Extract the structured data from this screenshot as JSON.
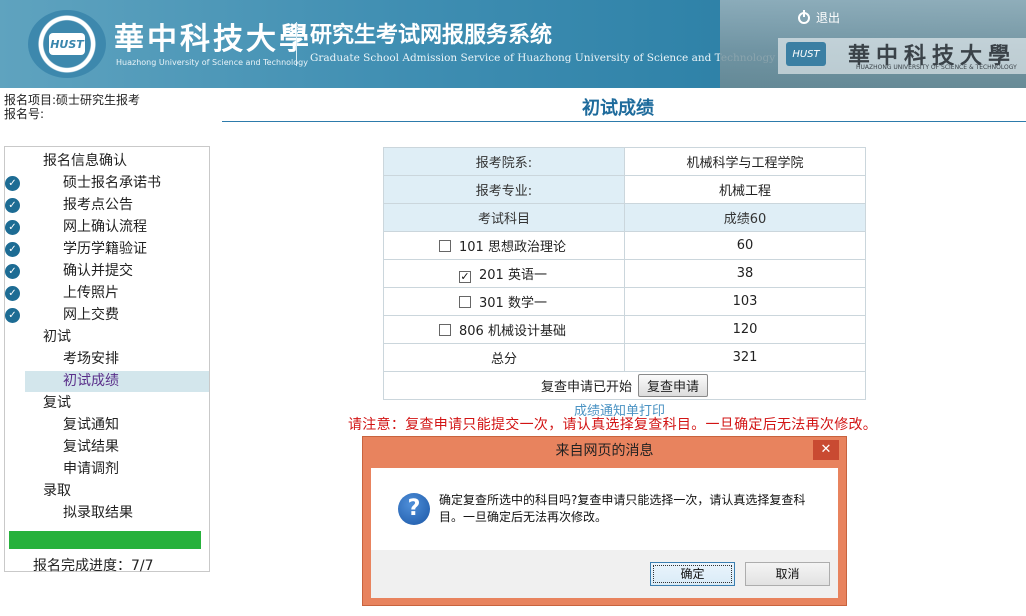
{
  "header": {
    "university_cn": "華中科技大學",
    "university_en": "Huazhong University of Science and Technology",
    "seal_text": "HUST",
    "system_cn": "研究生考试网报服务系统",
    "system_en": "Graduate School Admission Service of Huazhong University of Science and Technology",
    "photo_text": "華中科技大學",
    "photo_subtext": "HUAZHONG UNIVERSITY OF SCIENCE & TECHNOLOGY",
    "logout_label": "退出"
  },
  "info": {
    "project_label": "报名项目:",
    "project_value": "硕士研究生报考",
    "reg_no_label": "报名号:",
    "reg_no_value": ""
  },
  "page_title": "初试成绩",
  "sidebar": {
    "sections": [
      {
        "label": "报名信息确认"
      },
      {
        "label": "初试"
      },
      {
        "label": "复试"
      },
      {
        "label": "录取"
      }
    ],
    "items_reg": [
      {
        "label": "硕士报名承诺书"
      },
      {
        "label": "报考点公告"
      },
      {
        "label": "网上确认流程"
      },
      {
        "label": "学历学籍验证"
      },
      {
        "label": "确认并提交"
      },
      {
        "label": "上传照片"
      },
      {
        "label": "网上交费"
      }
    ],
    "items_prelim": [
      {
        "label": "考场安排"
      },
      {
        "label": "初试成绩"
      }
    ],
    "items_retest": [
      {
        "label": "复试通知"
      },
      {
        "label": "复试结果"
      },
      {
        "label": "申请调剂"
      }
    ],
    "items_admit": [
      {
        "label": "拟录取结果"
      }
    ],
    "progress_fraction": 1.0,
    "progress_text": "报名完成进度：7/7"
  },
  "scores": {
    "dept_label": "报考院系:",
    "dept_value": "机械科学与工程学院",
    "major_label": "报考专业:",
    "major_value": "机械工程",
    "subject_header": "考试科目",
    "score_header": "成绩60",
    "subjects": [
      {
        "name": "101 思想政治理论",
        "score": "60",
        "checked": false
      },
      {
        "name": "201 英语一",
        "score": "38",
        "checked": true
      },
      {
        "name": "301 数学一",
        "score": "103",
        "checked": false
      },
      {
        "name": "806 机械设计基础",
        "score": "120",
        "checked": false
      }
    ],
    "total_label": "总分",
    "total_value": "321",
    "recheck_status": "复查申请已开始",
    "recheck_button": "复查申请",
    "print_link": "成绩通知单打印",
    "notice": "请注意：复查申请只能提交一次，请认真选择复查科目。一旦确定后无法再次修改。"
  },
  "dialog": {
    "title": "来自网页的消息",
    "close_label": "✕",
    "message": "确定复查所选中的科目吗?复查申请只能选择一次，请认真选择复查科目。一旦确定后无法再次修改。",
    "ok_label": "确定",
    "cancel_label": "取消"
  }
}
